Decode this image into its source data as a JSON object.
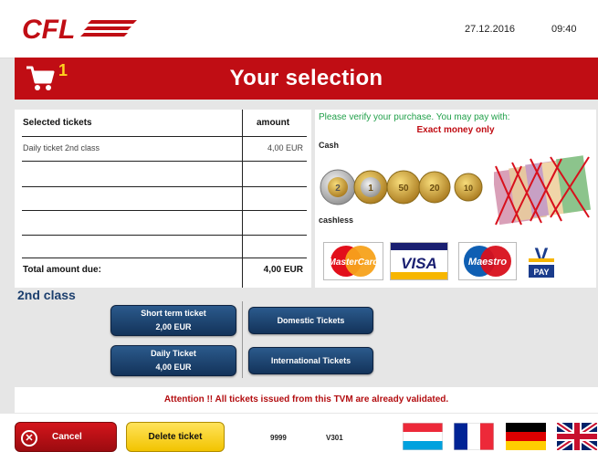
{
  "header": {
    "logo_text": "CFL",
    "date": "27.12.2016",
    "time": "09:40"
  },
  "titlebar": {
    "cart_count": "1",
    "title": "Your selection"
  },
  "tickets": {
    "col_name": "Selected tickets",
    "col_amount": "amount",
    "rows": [
      {
        "name": "Daily ticket 2nd class",
        "amount": "4,00 EUR"
      }
    ],
    "total_label": "Total amount due:",
    "total_value": "4,00 EUR"
  },
  "payment": {
    "verify_text": "Please verify your purchase. You may pay with:",
    "exact_text": "Exact money only",
    "cash_label": "Cash",
    "cashless_label": "cashless",
    "coins": [
      "2",
      "1",
      "50",
      "20",
      "10"
    ],
    "cards": {
      "mastercard": "MasterCard",
      "visa": "VISA",
      "maestro": "Maestro",
      "vpay_letter": "V",
      "vpay_text": "PAY"
    }
  },
  "selection": {
    "class_label": "2nd class",
    "short_term": {
      "title": "Short term ticket",
      "price": "2,00 EUR"
    },
    "daily": {
      "title": "Daily Ticket",
      "price": "4,00 EUR"
    },
    "domestic": "Domestic Tickets",
    "international": "International Tickets"
  },
  "attention": "Attention !! All tickets issued from this TVM are already validated.",
  "footer": {
    "cancel": "Cancel",
    "delete": "Delete ticket",
    "code1": "9999",
    "code2": "V301"
  },
  "colors": {
    "brand_red": "#c00d14",
    "button_blue": "#1f4a7a",
    "delete_yellow": "#f7d31c",
    "verify_green": "#21a04a"
  }
}
